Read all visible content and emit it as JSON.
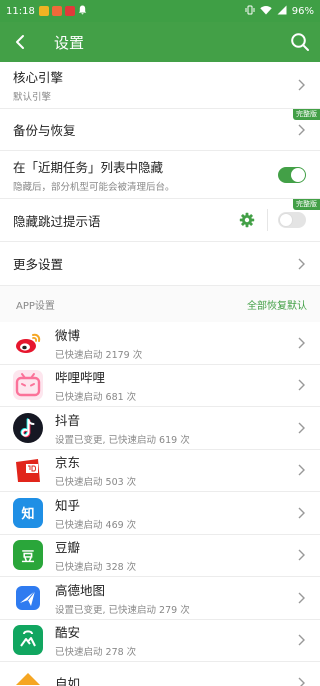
{
  "status": {
    "time": "11:18",
    "battery": "96%",
    "mini_colors": [
      "#f0b323",
      "#f06a3a",
      "#e03a3a"
    ]
  },
  "header": {
    "title": "设置"
  },
  "settings": {
    "core_engine": {
      "title": "核心引擎",
      "subtitle": "默认引擎"
    },
    "backup": {
      "title": "备份与恢复",
      "badge": "完整版"
    },
    "hide_recent": {
      "title": "在「近期任务」列表中隐藏",
      "subtitle": "隐藏后，部分机型可能会被清理后台。",
      "enabled": true
    },
    "hide_skip": {
      "title": "隐藏跳过提示语",
      "badge": "完整版",
      "enabled": false
    },
    "more": {
      "title": "更多设置"
    }
  },
  "apps_section": {
    "label": "APP设置",
    "action": "全部恢复默认"
  },
  "apps": [
    {
      "name": "微博",
      "stat": "已快速启动 2179 次",
      "icon": "weibo-icon",
      "color": "#ffffff"
    },
    {
      "name": "哔哩哔哩",
      "stat": "已快速启动 681 次",
      "icon": "bilibili-icon",
      "color": "#fb7299"
    },
    {
      "name": "抖音",
      "stat": "设置已变更, 已快速启动 619 次",
      "icon": "douyin-icon",
      "color": "#161823"
    },
    {
      "name": "京东",
      "stat": "已快速启动 503 次",
      "icon": "jd-icon",
      "color": "#e1251b"
    },
    {
      "name": "知乎",
      "stat": "已快速启动 469 次",
      "icon": "zhihu-icon",
      "color": "#1f8fe5",
      "glyph": "知"
    },
    {
      "name": "豆瓣",
      "stat": "已快速启动 328 次",
      "icon": "douban-icon",
      "color": "#2aa63a",
      "glyph": "豆"
    },
    {
      "name": "高德地图",
      "stat": "设置已变更, 已快速启动 279 次",
      "icon": "amap-icon",
      "color": "#2f7bf0"
    },
    {
      "name": "酷安",
      "stat": "已快速启动 278 次",
      "icon": "coolapk-icon",
      "color": "#11a660"
    },
    {
      "name": "自如",
      "stat": "",
      "icon": "ziroom-icon",
      "color": "#f5a623"
    }
  ]
}
